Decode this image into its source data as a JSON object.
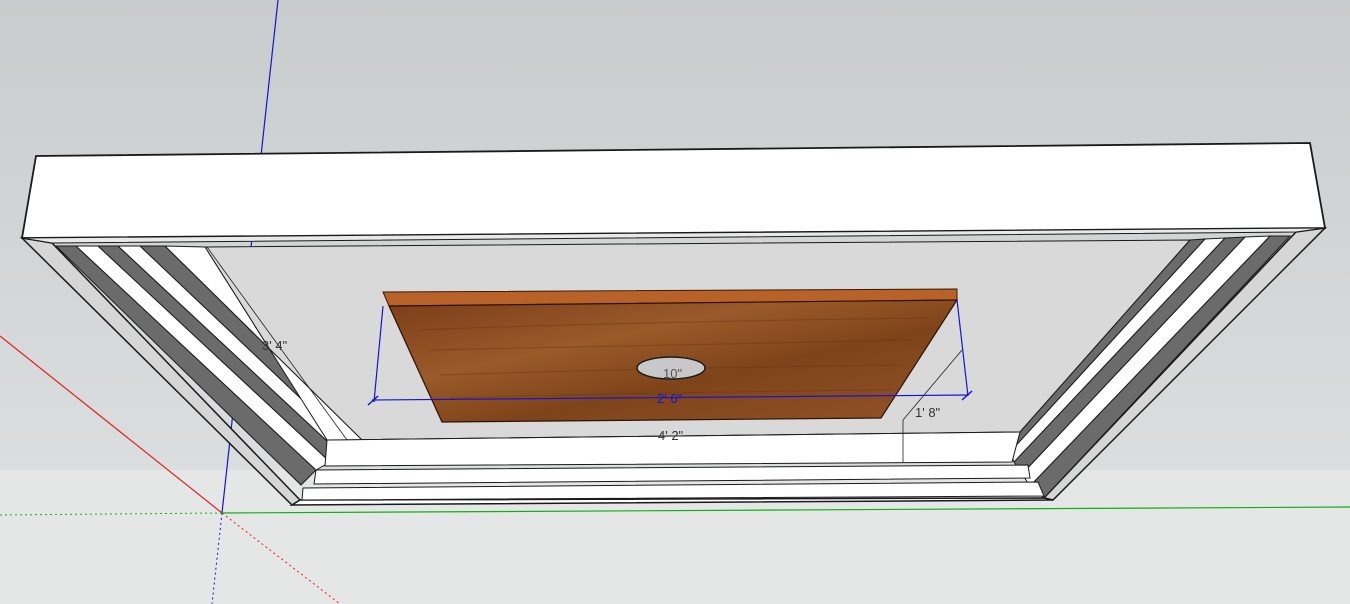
{
  "viewport": {
    "sky_top": "#c9cccc",
    "sky_bottom": "#e0e3e3",
    "ground": "#e5e7e7"
  },
  "model": {
    "frame_color": "#ffffff",
    "frame_edge": "#1a1a1a",
    "side_face_color": "#d6d6d6",
    "dark_strip_color": "#6b6b6b",
    "back_panel_color": "#d9d9d9",
    "wood_color": "#8a4a1e",
    "wood_edge_color": "#b8622a",
    "hole_color": "#c8c8c8"
  },
  "dimensions": {
    "height_label": "3' 4\"",
    "width_label": "4' 2\"",
    "board_width_label": "2' 6\"",
    "board_offset_label": "1' 8\"",
    "hole_label": "10\""
  },
  "axes": {
    "red": "#e02020",
    "green": "#10b010",
    "blue": "#1515d0"
  }
}
